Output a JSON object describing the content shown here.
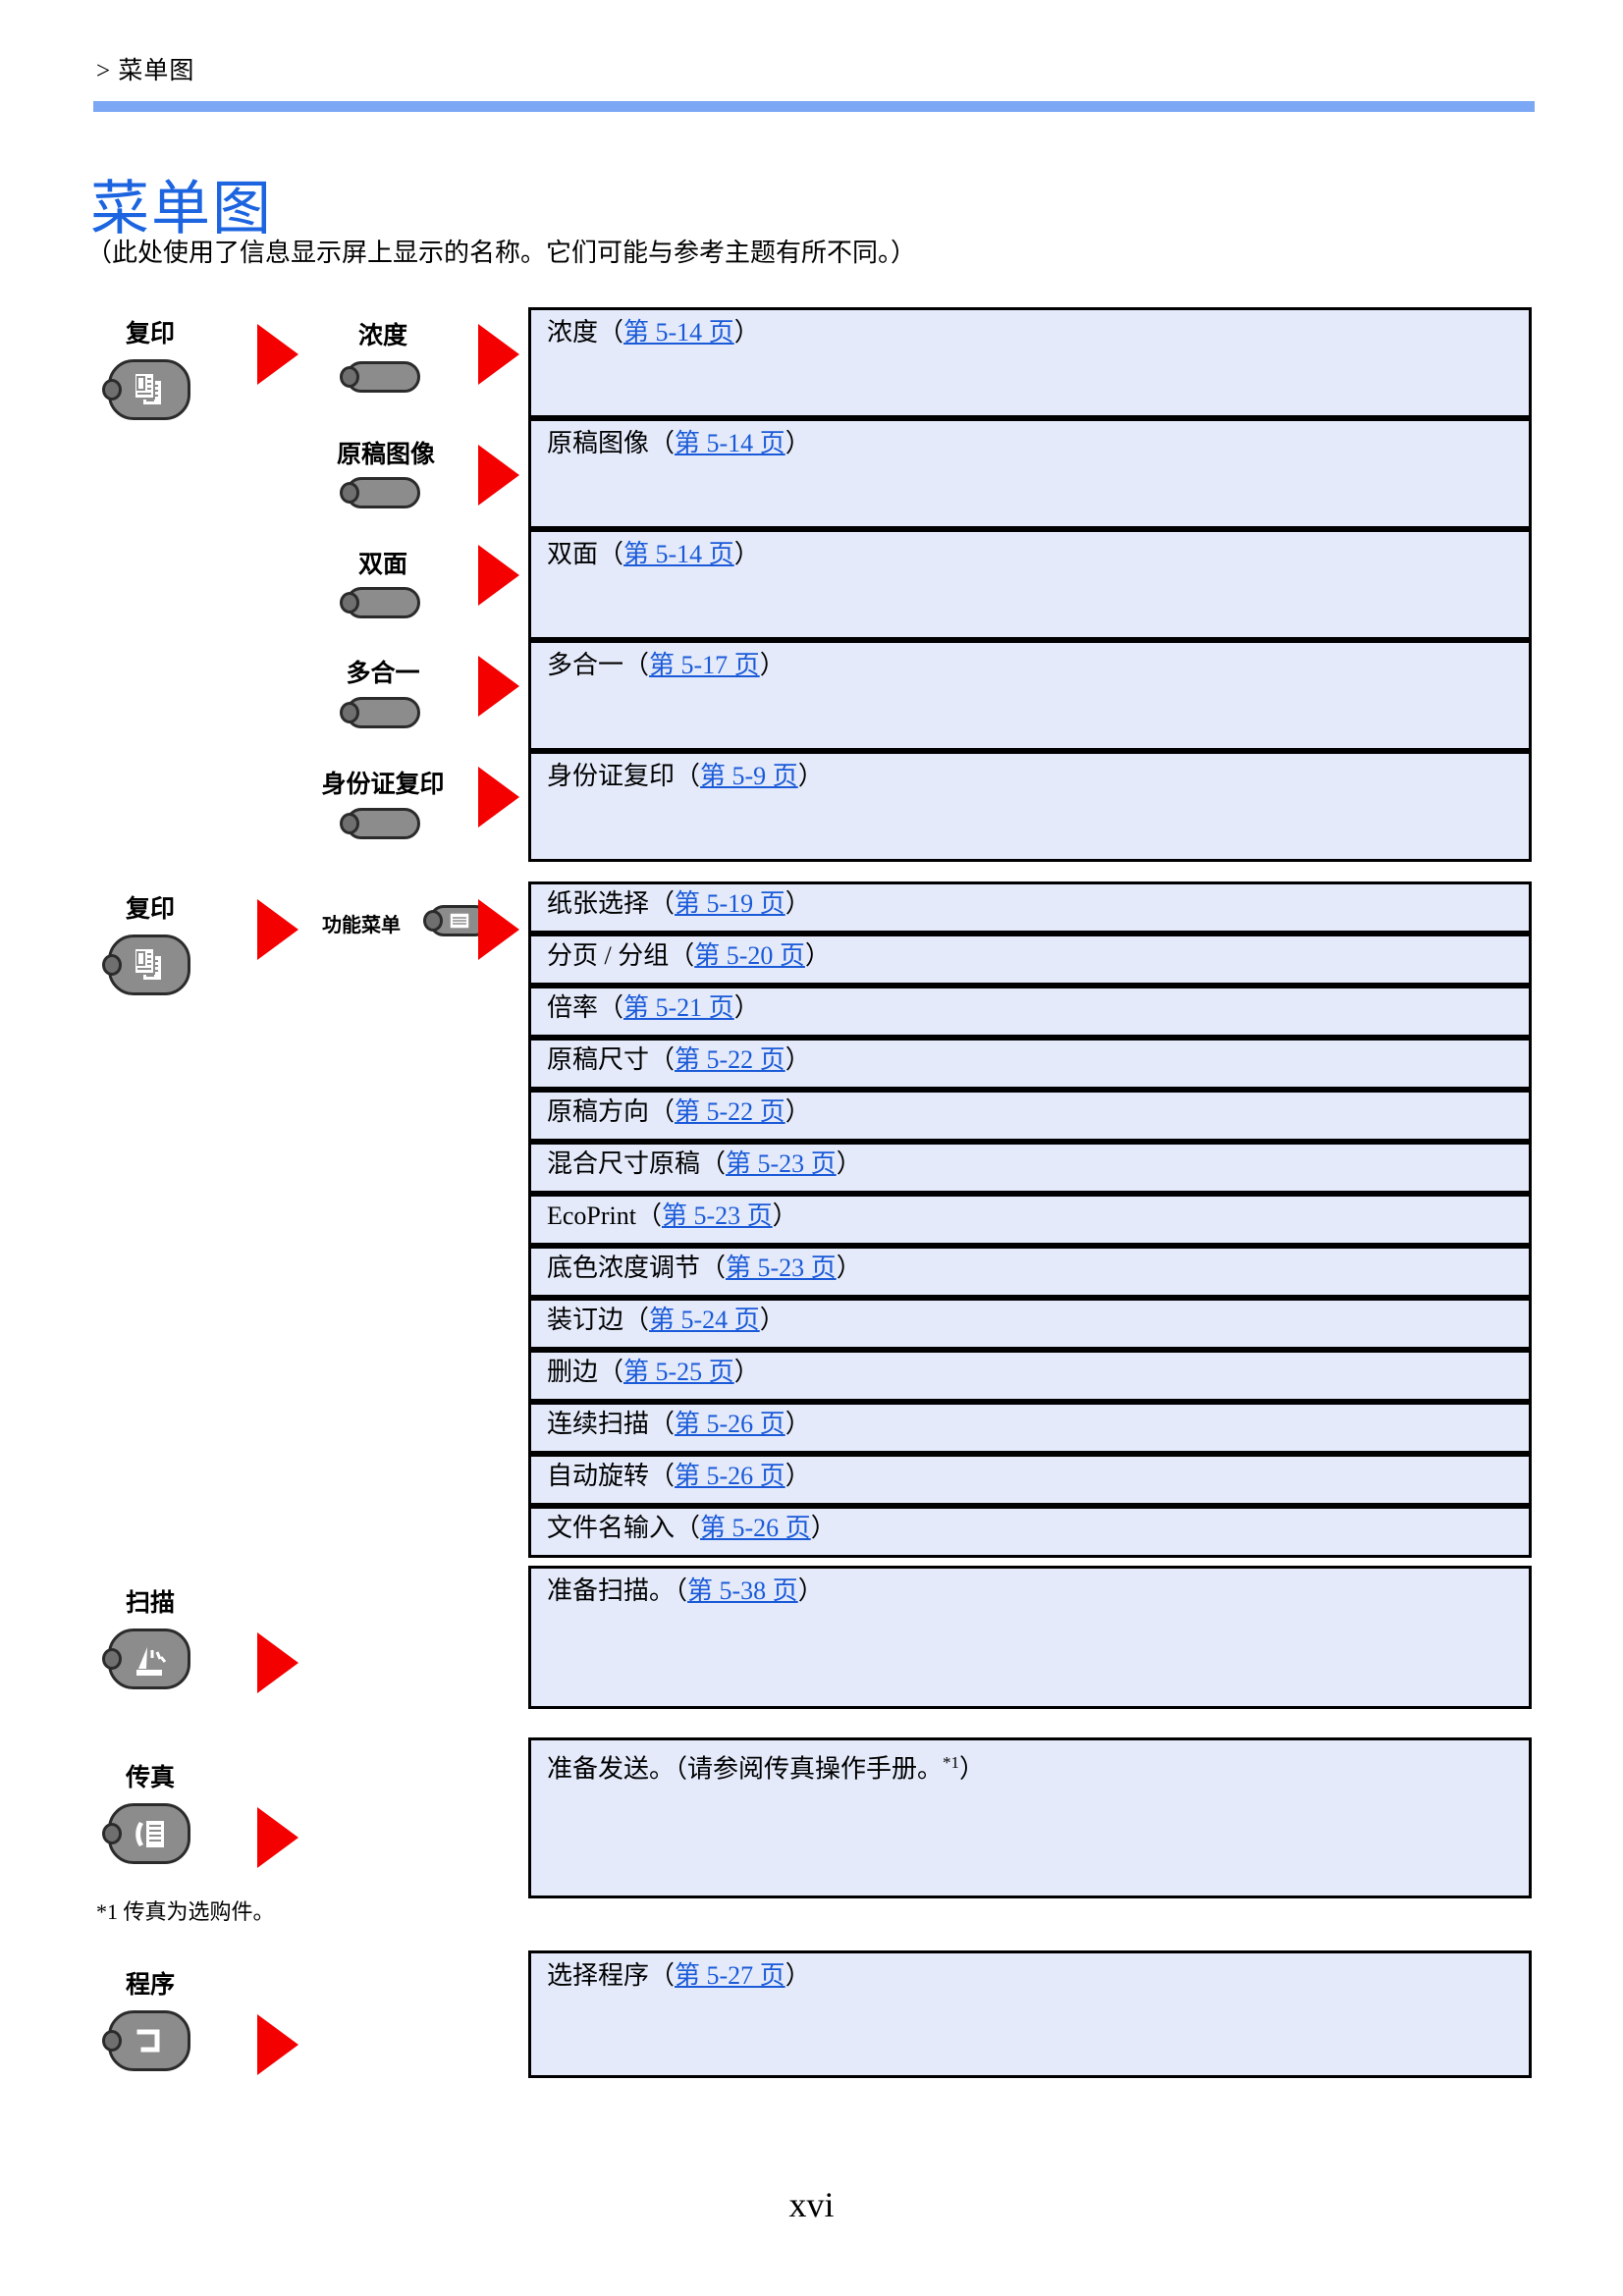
{
  "header": {
    "breadcrumb": "> 菜单图"
  },
  "title": "菜单图",
  "subtitle": "（此处使用了信息显示屏上显示的名称。它们可能与参考主题有所不同。）",
  "colors": {
    "rule": "#7ba7f5",
    "title": "#1c64e0",
    "arrow": "#f50000",
    "box_fill": "#e4eafa",
    "link": "#1a5ad8",
    "key_face": "#8c8c8c"
  },
  "sections": [
    {
      "key_label": "复印",
      "key_icon": "copy-icon",
      "submenus": [
        {
          "label": "浓度",
          "icon": "blank-pill-key"
        },
        {
          "label": "原稿图像",
          "icon": "blank-pill-key"
        },
        {
          "label": "双面",
          "icon": "blank-pill-key"
        },
        {
          "label": "多合一",
          "icon": "blank-pill-key"
        },
        {
          "label": "身份证复印",
          "icon": "blank-pill-key"
        }
      ],
      "boxes": [
        {
          "text": "浓度（",
          "link": "第 5-14 页",
          "tail": "）"
        },
        {
          "text": "原稿图像（",
          "link": "第 5-14 页",
          "tail": "）"
        },
        {
          "text": "双面（",
          "link": "第 5-14 页",
          "tail": "）"
        },
        {
          "text": "多合一（",
          "link": "第 5-17 页",
          "tail": "）"
        },
        {
          "text": "身份证复印（",
          "link": "第 5-9 页",
          "tail": "）"
        }
      ]
    },
    {
      "key_label": "复印",
      "key_icon": "copy-icon",
      "submenus": [
        {
          "label": "功能菜单",
          "icon": "function-menu-icon"
        }
      ],
      "boxes": [
        {
          "text": "纸张选择（",
          "link": "第 5-19 页",
          "tail": "）"
        },
        {
          "text": "分页 / 分组（",
          "link": "第 5-20 页",
          "tail": "）"
        },
        {
          "text": "倍率（",
          "link": "第 5-21 页",
          "tail": "）"
        },
        {
          "text": "原稿尺寸（",
          "link": "第 5-22 页",
          "tail": "）"
        },
        {
          "text": "原稿方向（",
          "link": "第 5-22 页",
          "tail": "）"
        },
        {
          "text": "混合尺寸原稿（",
          "link": "第 5-23 页",
          "tail": "）"
        },
        {
          "text": "EcoPrint（",
          "link": "第 5-23 页",
          "tail": "）"
        },
        {
          "text": "底色浓度调节（",
          "link": "第 5-23 页",
          "tail": "）"
        },
        {
          "text": "装订边（",
          "link": "第 5-24 页",
          "tail": "）"
        },
        {
          "text": "删边（",
          "link": "第 5-25 页",
          "tail": "）"
        },
        {
          "text": "连续扫描（",
          "link": "第 5-26 页",
          "tail": "）"
        },
        {
          "text": "自动旋转（",
          "link": "第 5-26 页",
          "tail": "）"
        },
        {
          "text": "文件名输入（",
          "link": "第 5-26 页",
          "tail": "）"
        }
      ]
    },
    {
      "key_label": "扫描",
      "key_icon": "scan-icon",
      "submenus": [],
      "boxes": [
        {
          "text": "准备扫描。（",
          "link": "第 5-38 页",
          "tail": "）"
        }
      ]
    },
    {
      "key_label": "传真",
      "key_icon": "fax-icon",
      "submenus": [],
      "boxes": [
        {
          "text": "准备发送。（请参阅传真操作手册。",
          "sup": "*1",
          "tail": "）"
        }
      ]
    },
    {
      "key_label": "程序",
      "key_icon": "program-icon",
      "submenus": [],
      "boxes": [
        {
          "text": "选择程序（",
          "link": "第 5-27 页",
          "tail": "）"
        }
      ]
    }
  ],
  "footnote": "*1 传真为选购件。",
  "page_number": "xvi"
}
